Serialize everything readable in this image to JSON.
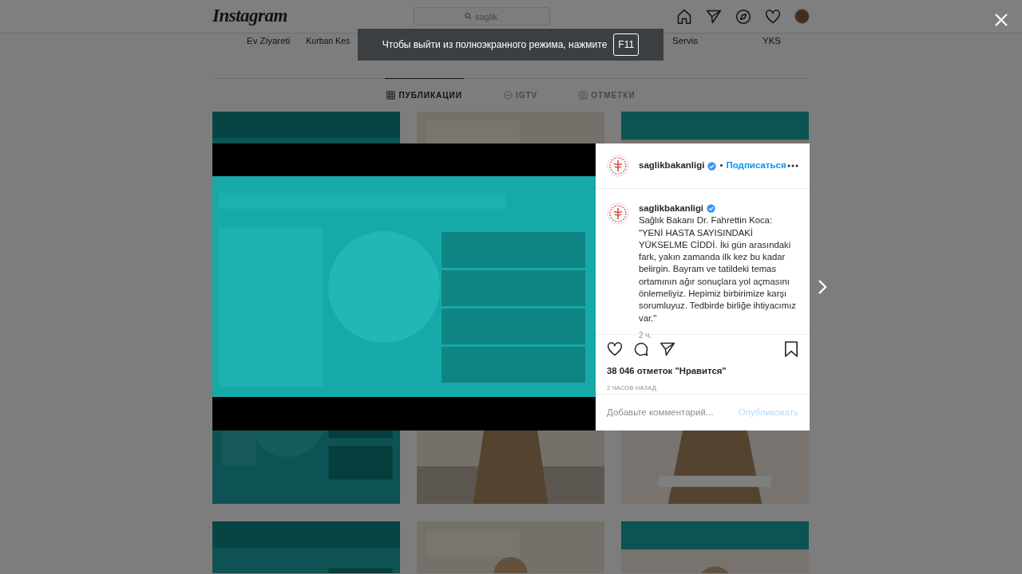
{
  "header": {
    "logo": "Instagram",
    "search": {
      "value": "saglik"
    }
  },
  "highlights": [
    {
      "label": "Ev Ziyareti"
    },
    {
      "label": "Kurban Kes"
    },
    {
      "label": "Servis"
    },
    {
      "label": "YKS"
    }
  ],
  "tabs": [
    {
      "label": "ПУБЛИКАЦИИ",
      "kind": "grid",
      "selected": true
    },
    {
      "label": "IGTV",
      "kind": "igtv",
      "selected": false
    },
    {
      "label": "ОТМЕТКИ",
      "kind": "tagged",
      "selected": false
    }
  ],
  "fullscreen_notice": {
    "text": "Чтобы выйти из полноэкранного режима, нажмите",
    "key": "F11"
  },
  "post": {
    "author": {
      "username": "saglikbakanligi",
      "verified": true,
      "separator": "•",
      "follow": "Подписаться"
    },
    "caption": {
      "username": "saglikbakanligi",
      "verified": true,
      "text": "Sağlık Bakanı Dr. Fahrettin Koca: \"YENİ HASTA SAYISINDAKİ YÜKSELME CİDDİ. İki gün arasındaki fark, yakın zamanda ilk kez bu kadar belirgin. Bayram ve tatildeki temas ortamının ağır sonuçlara yol açmasını önlemeliyiz. Hepimiz birbirimize karşı sorumluyuz. Tedbirde birliğe ihtiyacımız var.\"",
      "time": "2 ч."
    },
    "liked": false,
    "saved": false,
    "likes": "38 046 отметок \"Нравится\"",
    "time": "2 ЧАСОВ НАЗАД",
    "comment": {
      "placeholder": "Добавьте комментарий...",
      "submit": "Опубликовать"
    }
  }
}
